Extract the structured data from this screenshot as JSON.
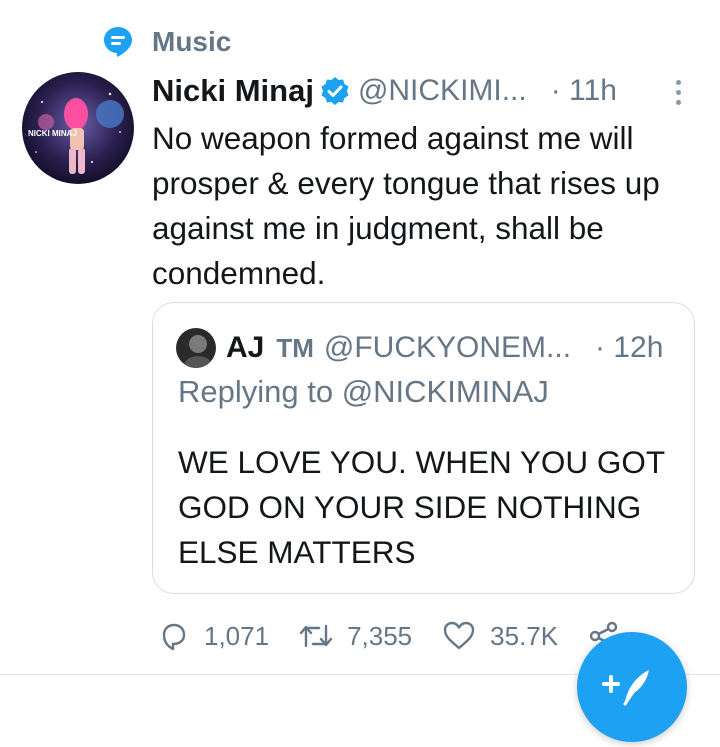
{
  "context": {
    "label": "Music",
    "icon": "topic-icon"
  },
  "tweet": {
    "author_name": "Nicki Minaj",
    "verified": true,
    "handle": "@NICKIMI...",
    "time": "· 11h",
    "text": "No weapon formed against me will prosper & every tongue that rises up against me in judgment, shall be condemned.",
    "avatar_text": "NICKI MINAJ"
  },
  "quoted_tweet": {
    "author_name": "AJ",
    "badge": "TM",
    "handle": "@FUCKYONEM...",
    "time": "· 12h",
    "replying_to": "Replying to @NICKIMINAJ",
    "text": "WE LOVE YOU. WHEN YOU GOT GOD ON YOUR SIDE NOTHING ELSE MATTERS"
  },
  "actions": {
    "replies": "1,071",
    "retweets": "7,355",
    "likes": "35.7K"
  },
  "colors": {
    "accent": "#1da1f2",
    "secondary_text": "#657786",
    "primary_text": "#14171a"
  }
}
